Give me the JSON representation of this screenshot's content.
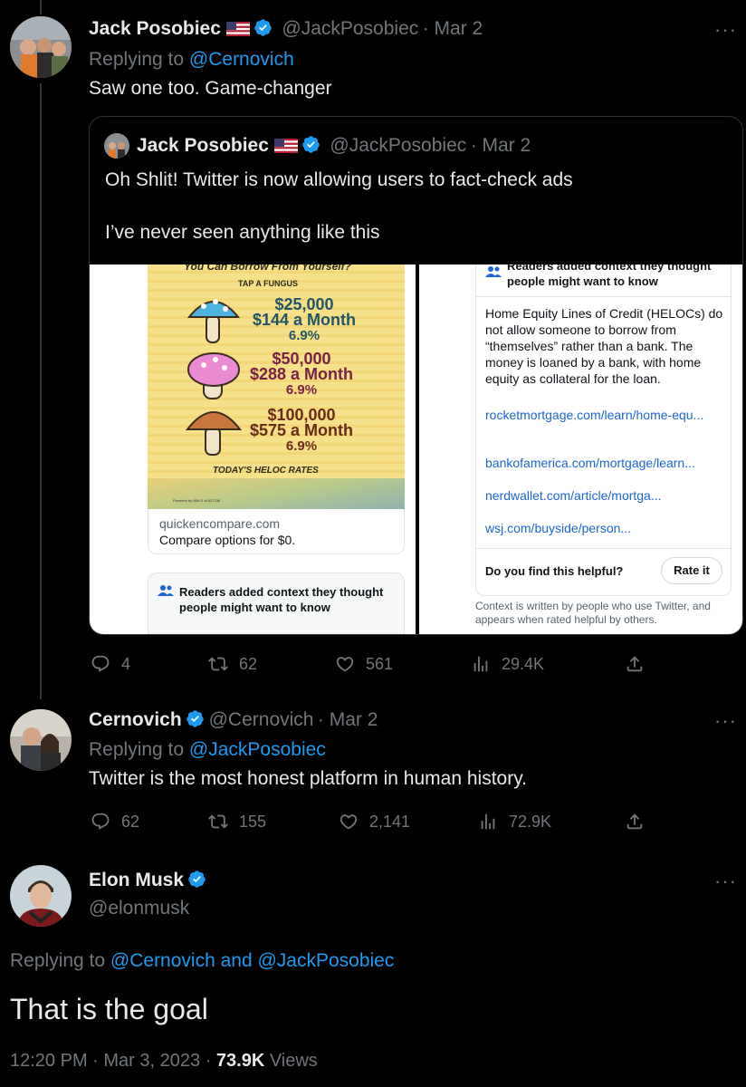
{
  "tweet1": {
    "name": "Jack Posobiec",
    "handle": "@JackPosobiec",
    "date": "· Mar 2",
    "replying_prefix": "Replying to ",
    "replying_to": "@Cernovich",
    "text": "Saw one too. Game-changer",
    "more": "···",
    "stats": {
      "replies": "4",
      "retweets": "62",
      "likes": "561",
      "views": "29.4K"
    }
  },
  "quote": {
    "name": "Jack Posobiec",
    "handle": "@JackPosobiec",
    "date": "· Mar 2",
    "line1": "Oh Shlit! Twitter is now allowing users to fact-check ads",
    "line2": "I’ve never seen anything like this"
  },
  "ad": {
    "header": "You Can Borrow From Yourself?",
    "tap": "TAP A FUNGUS",
    "rates": [
      {
        "amount": "$25,000",
        "monthly": "$144 a Month",
        "rate": "6.9%"
      },
      {
        "amount": "$50,000",
        "monthly": "$288 a Month",
        "rate": "6.9%"
      },
      {
        "amount": "$100,000",
        "monthly": "$575 a Month",
        "rate": "6.9%"
      }
    ],
    "footer": "TODAY'S HELOC RATES",
    "powered": "Powered by NMLS #1427236",
    "domain": "quickencompare.com",
    "cta": "Compare options for $0.",
    "context_title": "Readers added context they thought people might want to know"
  },
  "note": {
    "title": "Readers added context they thought people might want to know",
    "body": "Home Equity Lines of Credit (HELOCs) do not allow someone to borrow from “themselves” rather than a bank. The money is loaned by a bank, with home equity as collateral for the loan.",
    "links": [
      "rocketmortgage.com/learn/home-equ...",
      "bankofamerica.com/mortgage/learn...",
      "nerdwallet.com/article/mortga...",
      "wsj.com/buyside/person..."
    ],
    "question": "Do you find this helpful?",
    "rate_button": "Rate it",
    "footer": "Context is written by people who use Twitter, and appears when rated helpful by others."
  },
  "tweet2": {
    "name": "Cernovich",
    "handle": "@Cernovich",
    "date": "· Mar 2",
    "replying_prefix": "Replying to ",
    "replying_to": "@JackPosobiec",
    "text": "Twitter is the most honest platform in human history.",
    "more": "···",
    "stats": {
      "replies": "62",
      "retweets": "155",
      "likes": "2,141",
      "views": "72.9K"
    }
  },
  "tweet3": {
    "name": "Elon Musk",
    "handle": "@elonmusk",
    "replying_prefix": "Replying to ",
    "replying_to": "@Cernovich and @JackPosobiec",
    "text": "That is the goal",
    "more": "···",
    "time": "12:20 PM · Mar 3, 2023 · ",
    "views": "73.9K",
    "views_label": " Views"
  },
  "colors": {
    "background": "#000000",
    "accent": "#1d9bf0",
    "muted": "#71767b",
    "text": "#e7e9ea"
  }
}
